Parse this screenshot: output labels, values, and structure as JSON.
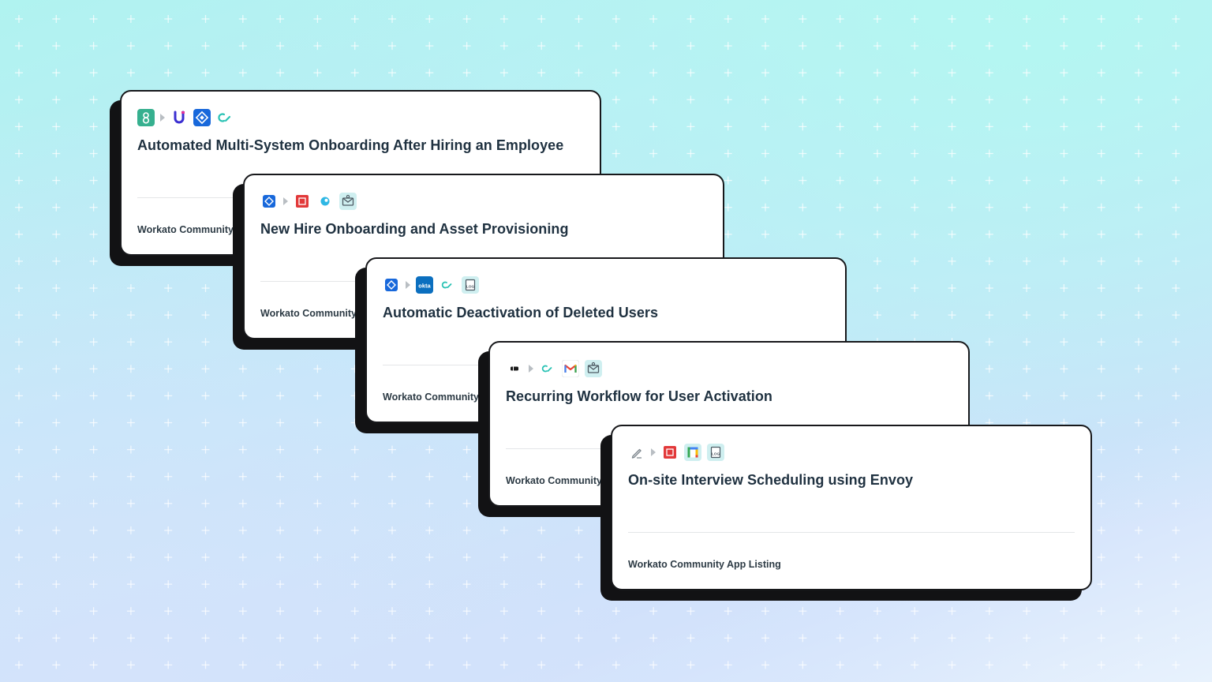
{
  "background": {
    "colors": [
      "#b0f3f0",
      "#c2e9f9",
      "#cfe0fb",
      "#e8f2fd"
    ],
    "pattern": "plus-grid"
  },
  "cards": [
    {
      "title": "Automated Multi-System Onboarding After Hiring an Employee",
      "source": "Workato Community",
      "icons": [
        "greenhouse-icon",
        "arrow-right-icon",
        "u-connector-icon",
        "jira-icon",
        "workato-icon"
      ]
    },
    {
      "title": "New Hire Onboarding and Asset Provisioning",
      "source": "Workato Community",
      "icons": [
        "jira-icon",
        "arrow-right-icon",
        "email-red-icon",
        "bubble-icon",
        "email-message-icon"
      ]
    },
    {
      "title": "Automatic Deactivation of Deleted Users",
      "source": "Workato Community",
      "icons": [
        "jira-icon",
        "arrow-right-icon",
        "okta-icon",
        "workato-icon",
        "logger-icon"
      ]
    },
    {
      "title": "Recurring Workflow for User Activation",
      "source": "Workato Community",
      "icons": [
        "scheduler-icon",
        "arrow-right-icon",
        "workato-icon",
        "gmail-icon",
        "email-message-icon"
      ]
    },
    {
      "title": "On-site Interview Scheduling using Envoy",
      "source": "Workato Community App Listing",
      "icons": [
        "pen-icon",
        "arrow-right-icon",
        "email-red-icon",
        "google-calendar-icon",
        "logger-icon"
      ]
    }
  ],
  "icon_labels": {
    "okta": "okta",
    "log": "LOG"
  },
  "colors": {
    "card_border": "#17181b",
    "card_shadow": "#121214",
    "title_text": "#1f3140",
    "jira_blue": "#1868db",
    "workato_teal": "#29c2b4",
    "greenhouse_green": "#36b08f",
    "okta_blue": "#0b6fbf",
    "email_red": "#e2393a"
  }
}
